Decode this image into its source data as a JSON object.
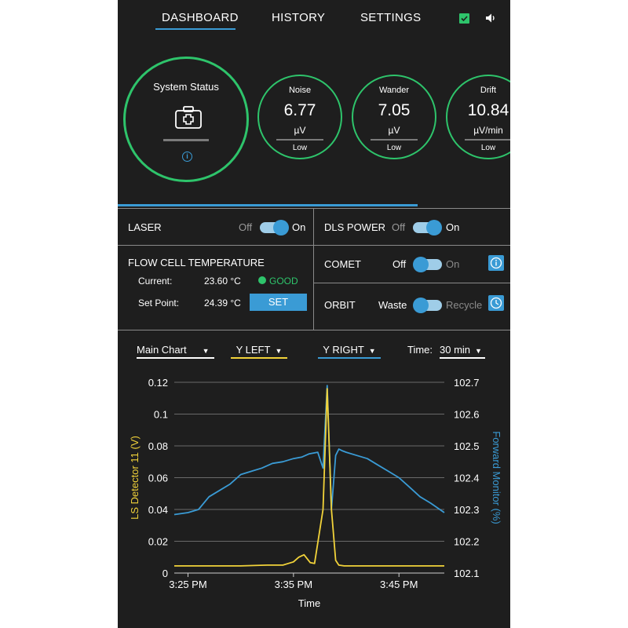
{
  "nav": {
    "tabs": [
      "DASHBOARD",
      "HISTORY",
      "SETTINGS"
    ],
    "active_tab": "DASHBOARD"
  },
  "status": {
    "system_title": "System Status",
    "ring_color": "#2ec46b",
    "metrics": [
      {
        "title": "Noise",
        "value": "6.77",
        "unit": "µV",
        "level": "Low"
      },
      {
        "title": "Wander",
        "value": "7.05",
        "unit": "µV",
        "level": "Low"
      },
      {
        "title": "Drift",
        "value": "10.84",
        "unit": "µV/min",
        "level": "Low"
      }
    ]
  },
  "controls": {
    "laser": {
      "label": "LASER",
      "off": "Off",
      "on": "On",
      "state": "On"
    },
    "dls_power": {
      "label": "DLS POWER",
      "off": "Off",
      "on": "On",
      "state": "On"
    },
    "flow_cell": {
      "label": "FLOW CELL TEMPERATURE",
      "current_label": "Current:",
      "current_value": "23.60 °C",
      "status": "GOOD",
      "setpoint_label": "Set Point:",
      "setpoint_value": "24.39 °C",
      "set_button": "SET"
    },
    "comet": {
      "label": "COMET",
      "off": "Off",
      "on": "On",
      "state": "Off"
    },
    "orbit": {
      "label": "ORBIT",
      "off": "Waste",
      "on": "Recycle",
      "state": "Waste"
    }
  },
  "chart_controls": {
    "main_chart": "Main Chart",
    "y_left": "Y LEFT",
    "y_right": "Y RIGHT",
    "time_label": "Time:",
    "time_value": "30 min"
  },
  "colors": {
    "accent": "#3a9bd5",
    "good": "#2ec46b",
    "left_series": "#f2d33a",
    "right_series": "#3a9bd5"
  },
  "chart_data": {
    "type": "line",
    "xlabel": "Time",
    "ylabel_left": "LS Detector 11 (V)",
    "ylabel_right": "Forward Monitor (%)",
    "x_ticks": [
      "3:25 PM",
      "3:35 PM",
      "3:45 PM"
    ],
    "x_tick_minutes": [
      0,
      10,
      20
    ],
    "xlim_minutes": [
      -1.3,
      24.3
    ],
    "ylim_left": [
      0,
      0.12
    ],
    "yticks_left": [
      "0",
      "0.02",
      "0.04",
      "0.06",
      "0.08",
      "0.1",
      "0.12"
    ],
    "ylim_right": [
      102.1,
      102.7
    ],
    "yticks_right": [
      "102.1",
      "102.2",
      "102.3",
      "102.4",
      "102.5",
      "102.6",
      "102.7"
    ],
    "grid": true,
    "series": [
      {
        "axis": "left",
        "color": "#f2d33a",
        "x": [
          -1.3,
          5,
          7.5,
          8.5,
          9,
          9.5,
          10,
          10.5,
          11,
          11.6,
          12,
          12.8,
          13.2,
          13.6,
          14,
          14.3,
          14.8,
          15.5,
          17,
          20,
          24.3
        ],
        "y": [
          0.0045,
          0.0045,
          0.005,
          0.005,
          0.005,
          0.006,
          0.007,
          0.01,
          0.0115,
          0.0065,
          0.006,
          0.04,
          0.116,
          0.04,
          0.008,
          0.005,
          0.0045,
          0.0045,
          0.0045,
          0.0045,
          0.0045
        ]
      },
      {
        "axis": "right",
        "color": "#3a9bd5",
        "x": [
          -1.3,
          0,
          1,
          2,
          3,
          4,
          5,
          6,
          7,
          8,
          9,
          10,
          10.8,
          11.5,
          12.3,
          12.8,
          13.2,
          13.6,
          14,
          14.3,
          14.6,
          15,
          16,
          17,
          18,
          19,
          20,
          21,
          22,
          23,
          24.3
        ],
        "y": [
          102.284,
          102.29,
          102.3,
          102.34,
          102.36,
          102.38,
          102.41,
          102.42,
          102.43,
          102.445,
          102.45,
          102.46,
          102.465,
          102.475,
          102.48,
          102.43,
          102.69,
          102.3,
          102.47,
          102.49,
          102.485,
          102.48,
          102.47,
          102.46,
          102.44,
          102.42,
          102.4,
          102.37,
          102.34,
          102.32,
          102.29
        ]
      }
    ]
  }
}
